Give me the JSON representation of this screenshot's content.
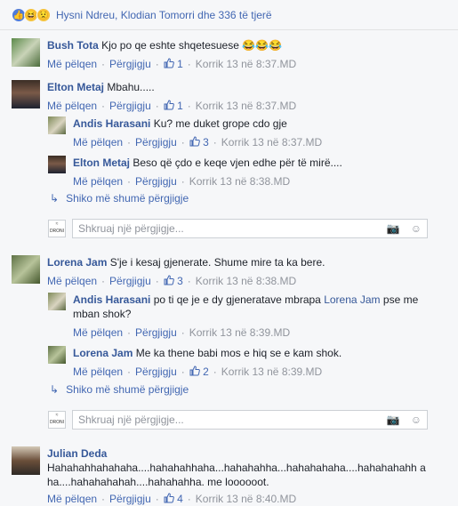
{
  "reactions": {
    "text": "Hysni Ndreu, Klodian Tomorri dhe 336 të tjerë"
  },
  "actions": {
    "like": "Më pëlqen",
    "reply": "Përgjigju",
    "see_more": "Shiko më shumë përgjigje",
    "placeholder": "Shkruaj një përgjigje..."
  },
  "comments": [
    {
      "name": "Bush Tota",
      "text": "Kjo po qe eshte shqetesuese 😂😂😂",
      "likes": "1",
      "time": "Korrik 13 në 8:37.MD"
    },
    {
      "name": "Elton Metaj",
      "text": "Mbahu.....",
      "likes": "1",
      "time": "Korrik 13 në 8:37.MD",
      "replies": [
        {
          "name": "Andis Harasani",
          "text": "Ku? me duket grope cdo gje",
          "likes": "3",
          "time": "Korrik 13 në 8:37.MD"
        },
        {
          "name": "Elton Metaj",
          "text": "Beso që çdo e keqe vjen edhe për të mirë....",
          "likes": "",
          "time": "Korrik 13 në 8:38.MD"
        }
      ]
    },
    {
      "name": "Lorena Jam",
      "text": "S'je i kesaj gjenerate. Shume mire ta ka bere.",
      "likes": "3",
      "time": "Korrik 13 në 8:38.MD",
      "replies": [
        {
          "name": "Andis Harasani",
          "text_a": "po ti qe je e dy gjeneratave mbrapa",
          "mention": "Lorena Jam",
          "text_b": "pse me mban shok?",
          "likes": "",
          "time": "Korrik 13 në 8:39.MD"
        },
        {
          "name": "Lorena Jam",
          "text": "Me ka thene babi mos e hiq se e kam shok.",
          "likes": "2",
          "time": "Korrik 13 në 8:39.MD"
        }
      ]
    },
    {
      "name": "Julian Deda",
      "text": "Hahahahhahahaha....hahahahhaha...hahahahha...hahahahaha....hahahahahh aha....hahahahahah....hahahahha. me loooooot.",
      "likes": "4",
      "time": "Korrik 13 në 8:40.MD"
    }
  ],
  "logo_text": "DRONI"
}
